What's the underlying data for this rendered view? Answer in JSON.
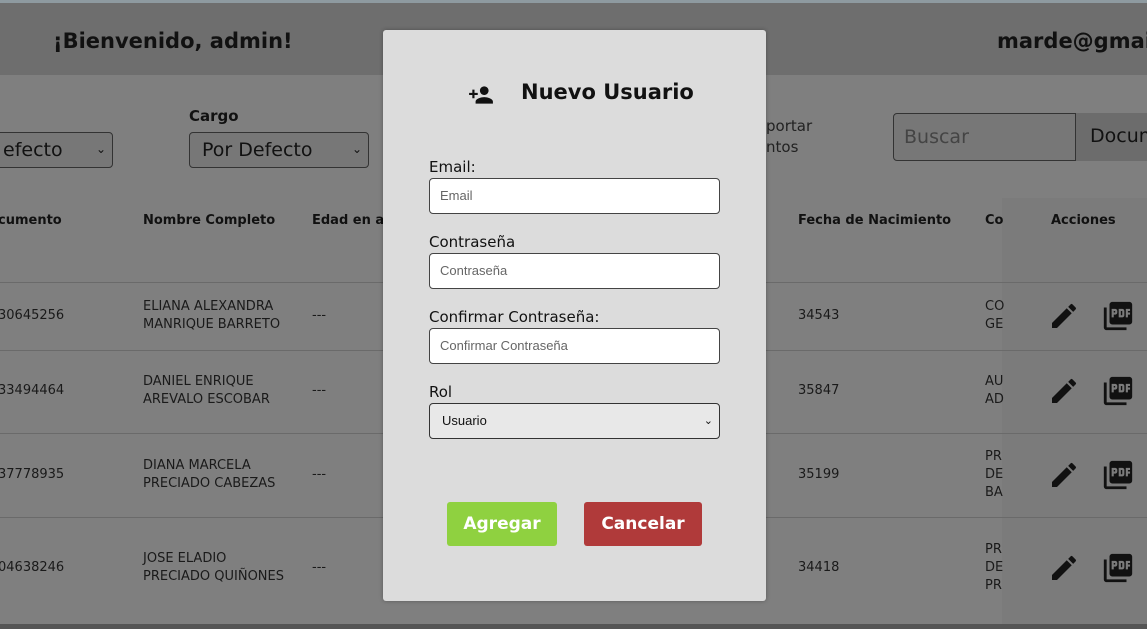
{
  "header": {
    "welcome": "¡Bienvenido, admin!",
    "user_email": "marde@gmail.c"
  },
  "filters": {
    "first_select_value": "efecto",
    "cargo_label": "Cargo",
    "cargo_value": "Por Defecto",
    "export_line1": "portar",
    "export_line2": "ntos",
    "search_placeholder": "Buscar",
    "search_button": "Docum"
  },
  "table": {
    "headers": [
      "cumento",
      "Nombre Completo",
      "Edad en añ",
      "Fecha de Nacimiento",
      "Co",
      "Acciones"
    ],
    "rows": [
      {
        "doc": "30645256",
        "name1": "ELIANA ALEXANDRA",
        "name2": "MANRIQUE BARRETO",
        "age": "---",
        "birth": "34543",
        "c1": "CO",
        "c2": "GE",
        "c3": ""
      },
      {
        "doc": "33494464",
        "name1": "DANIEL ENRIQUE",
        "name2": "AREVALO ESCOBAR",
        "age": "---",
        "birth": "35847",
        "c1": "AU",
        "c2": "AD",
        "c3": ""
      },
      {
        "doc": "37778935",
        "name1": "DIANA MARCELA",
        "name2": "PRECIADO CABEZAS",
        "age": "---",
        "birth": "35199",
        "c1": "PR",
        "c2": "DE",
        "c3": "BA"
      },
      {
        "doc": "04638246",
        "name1": "JOSE ELADIO",
        "name2": "PRECIADO QUIÑONES",
        "age": "---",
        "birth": "34418",
        "c1": "PR",
        "c2": "DE",
        "c3": "PR"
      }
    ]
  },
  "modal": {
    "title": "Nuevo Usuario",
    "email_label": "Email:",
    "email_placeholder": "Email",
    "password_label": "Contraseña",
    "password_placeholder": "Contraseña",
    "confirm_label": "Confirmar Contraseña:",
    "confirm_placeholder": "Confirmar Contraseña",
    "role_label": "Rol",
    "role_value": "Usuario",
    "add_button": "Agregar",
    "cancel_button": "Cancelar"
  },
  "colors": {
    "add_button": "#8fd140",
    "cancel_button": "#b03a3a",
    "overlay": "#7f7f7f"
  },
  "icons": [
    "user-plus-icon",
    "pencil-icon",
    "pdf-icon",
    "chevron-down-icon"
  ]
}
